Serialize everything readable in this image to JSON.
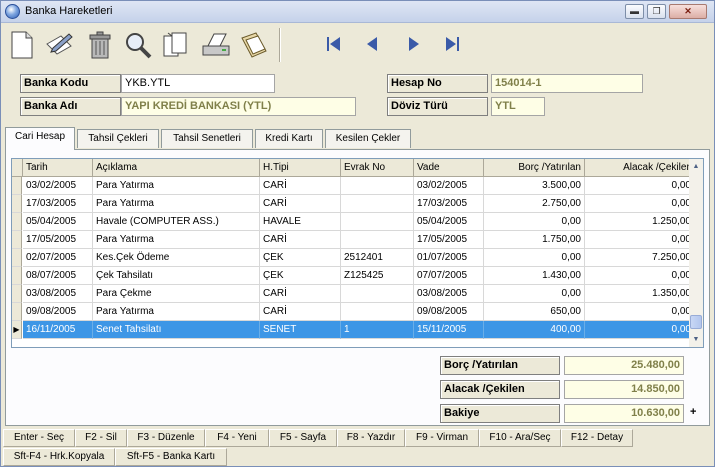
{
  "window": {
    "title": "Banka Hareketleri"
  },
  "header": {
    "banka_kodu_label": "Banka Kodu",
    "banka_kodu_value": "YKB.YTL",
    "banka_adi_label": "Banka Adı",
    "banka_adi_value": "YAPI KREDİ BANKASI (YTL)",
    "hesap_no_label": "Hesap No",
    "hesap_no_value": "154014-1",
    "doviz_turu_label": "Döviz Türü",
    "doviz_turu_value": "YTL"
  },
  "tabs": [
    "Cari Hesap",
    "Tahsil Çekleri",
    "Tahsil Senetleri",
    "Kredi Kartı",
    "Kesilen Çekler"
  ],
  "grid": {
    "columns": [
      "Tarih",
      "Açıklama",
      "H.Tipi",
      "Evrak No",
      "Vade",
      "Borç /Yatırılan",
      "Alacak /Çekilen"
    ],
    "rows": [
      [
        "03/02/2005",
        "Para Yatırma",
        "CARİ",
        "",
        "03/02/2005",
        "3.500,00",
        "0,00"
      ],
      [
        "17/03/2005",
        "Para Yatırma",
        "CARİ",
        "",
        "17/03/2005",
        "2.750,00",
        "0,00"
      ],
      [
        "05/04/2005",
        "Havale (COMPUTER ASS.)",
        "HAVALE",
        "",
        "05/04/2005",
        "0,00",
        "1.250,00"
      ],
      [
        "17/05/2005",
        "Para Yatırma",
        "CARİ",
        "",
        "17/05/2005",
        "1.750,00",
        "0,00"
      ],
      [
        "02/07/2005",
        "Kes.Çek Ödeme",
        "ÇEK",
        "2512401",
        "01/07/2005",
        "0,00",
        "7.250,00"
      ],
      [
        "08/07/2005",
        "Çek Tahsilatı",
        "ÇEK",
        "Z125425",
        "07/07/2005",
        "1.430,00",
        "0,00"
      ],
      [
        "03/08/2005",
        "Para Çekme",
        "CARİ",
        "",
        "03/08/2005",
        "0,00",
        "1.350,00"
      ],
      [
        "09/08/2005",
        "Para Yatırma",
        "CARİ",
        "",
        "09/08/2005",
        "650,00",
        "0,00"
      ],
      [
        "16/11/2005",
        "Senet Tahsilatı",
        "SENET",
        "1",
        "15/11/2005",
        "400,00",
        "0,00"
      ]
    ]
  },
  "totals": {
    "borc_label": "Borç /Yatırılan",
    "borc_value": "25.480,00",
    "alacak_label": "Alacak /Çekilen",
    "alacak_value": "14.850,00",
    "bakiye_label": "Bakiye",
    "bakiye_value": "10.630,00",
    "bakiye_sign": "+"
  },
  "function_keys": [
    "Enter - Seç",
    "F2 - Sil",
    "F3 - Düzenle",
    "F4 - Yeni",
    "F5 - Sayfa",
    "F8 - Yazdır",
    "F9 - Virman",
    "F10 - Ara/Seç",
    "F12 - Detay"
  ],
  "function_keys2": [
    "Sft-F4 - Hrk.Kopyala",
    "Sft-F5 - Banka Kartı"
  ],
  "toolbar_icons": [
    "new-document-icon",
    "edit-pencil-icon",
    "trash-icon",
    "search-icon",
    "copy-pages-icon",
    "printer-icon",
    "folder-icon"
  ],
  "nav_icons": [
    "first-record-icon",
    "previous-record-icon",
    "next-record-icon",
    "last-record-icon"
  ],
  "colors": {
    "selection": "#3d96e6",
    "cream_field": "#fefee6",
    "window_bg": "#ece9d8"
  }
}
